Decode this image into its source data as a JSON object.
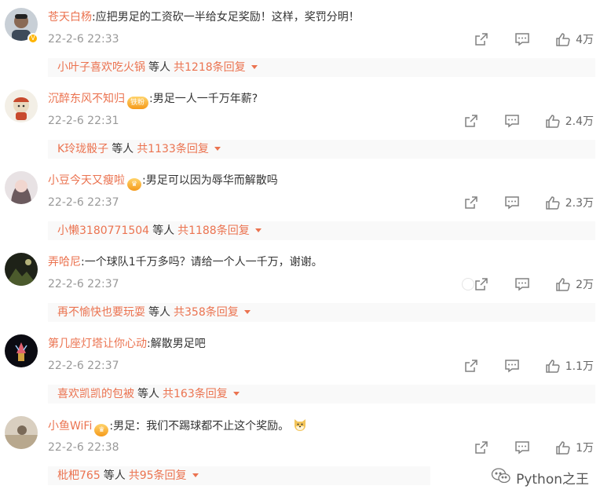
{
  "comments": [
    {
      "user": "苍天白杨",
      "text": ":应把男足的工资砍一半给女足奖励！这样，奖罚分明！",
      "time": "22-2-6 22:33",
      "likes": "4万",
      "reply_user": "小叶子喜欢吃火锅",
      "reply_etc": "等人",
      "reply_total": "共1218条回复",
      "badge": "",
      "verified_mark": "V"
    },
    {
      "user": "沉醉东风不知归",
      "text": ":男足一人一千万年薪?",
      "time": "22-2-6 22:31",
      "likes": "2.4万",
      "reply_user": "K玲珑骰子",
      "reply_etc": "等人",
      "reply_total": "共1133条回复",
      "badge": "铁粉"
    },
    {
      "user": "小豆今天又瘦啦",
      "text": ":男足可以因为辱华而解散吗",
      "time": "22-2-6 22:37",
      "likes": "2.3万",
      "reply_user": "小懒3180771504",
      "reply_etc": "等人",
      "reply_total": "共1188条回复",
      "badge": ""
    },
    {
      "user": "弄哈尼",
      "text": ":一个球队1千万多吗？请给一个人一千万，谢谢。",
      "time": "22-2-6 22:37",
      "likes": "2万",
      "reply_user": "再不愉快也要玩耍",
      "reply_etc": "等人",
      "reply_total": "共358条回复",
      "badge": ""
    },
    {
      "user": "第几座灯塔让你心动",
      "text": ":解散男足吧",
      "time": "22-2-6 22:37",
      "likes": "1.1万",
      "reply_user": "喜欢凯凯的包被",
      "reply_etc": "等人",
      "reply_total": "共163条回复",
      "badge": ""
    },
    {
      "user": "小鱼WiFi",
      "text": ":男足：我们不踢球都不止这个奖励。",
      "time": "22-2-6 22:38",
      "likes": "1万",
      "reply_user": "枇杷765",
      "reply_etc": "等人",
      "reply_total": "共95条回复",
      "badge": ""
    }
  ],
  "watermark": "Python之王",
  "colors": {
    "username": "#eb7350",
    "time": "#999999",
    "icon": "#808080",
    "reply_bg": "#f9f9f9"
  },
  "icons": [
    "share-icon",
    "comment-icon",
    "like-icon",
    "caret-down-icon",
    "wechat-icon",
    "dog-emoji-icon"
  ]
}
